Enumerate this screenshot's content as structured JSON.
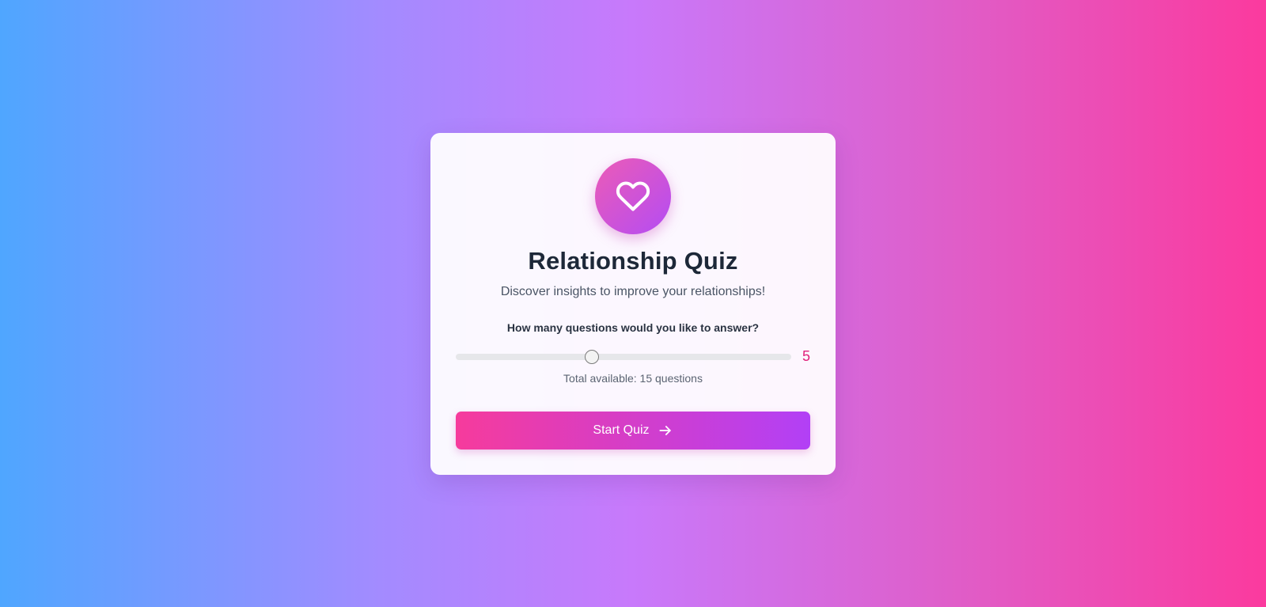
{
  "header": {
    "logo_icon": "heart-icon",
    "title": "Relationship Quiz",
    "subtitle": "Discover insights to improve your relationships!"
  },
  "question_selector": {
    "label": "How many questions would you like to answer?",
    "value": "5",
    "min": 1,
    "max": 15,
    "total_text": "Total available: 15 questions"
  },
  "start_button": {
    "label": "Start Quiz",
    "icon": "arrow-right-icon"
  },
  "colors": {
    "accent_pink": "#f63b9c",
    "accent_purple": "#b240f6",
    "value_color": "#e0207a",
    "title_color": "#1d2838"
  }
}
